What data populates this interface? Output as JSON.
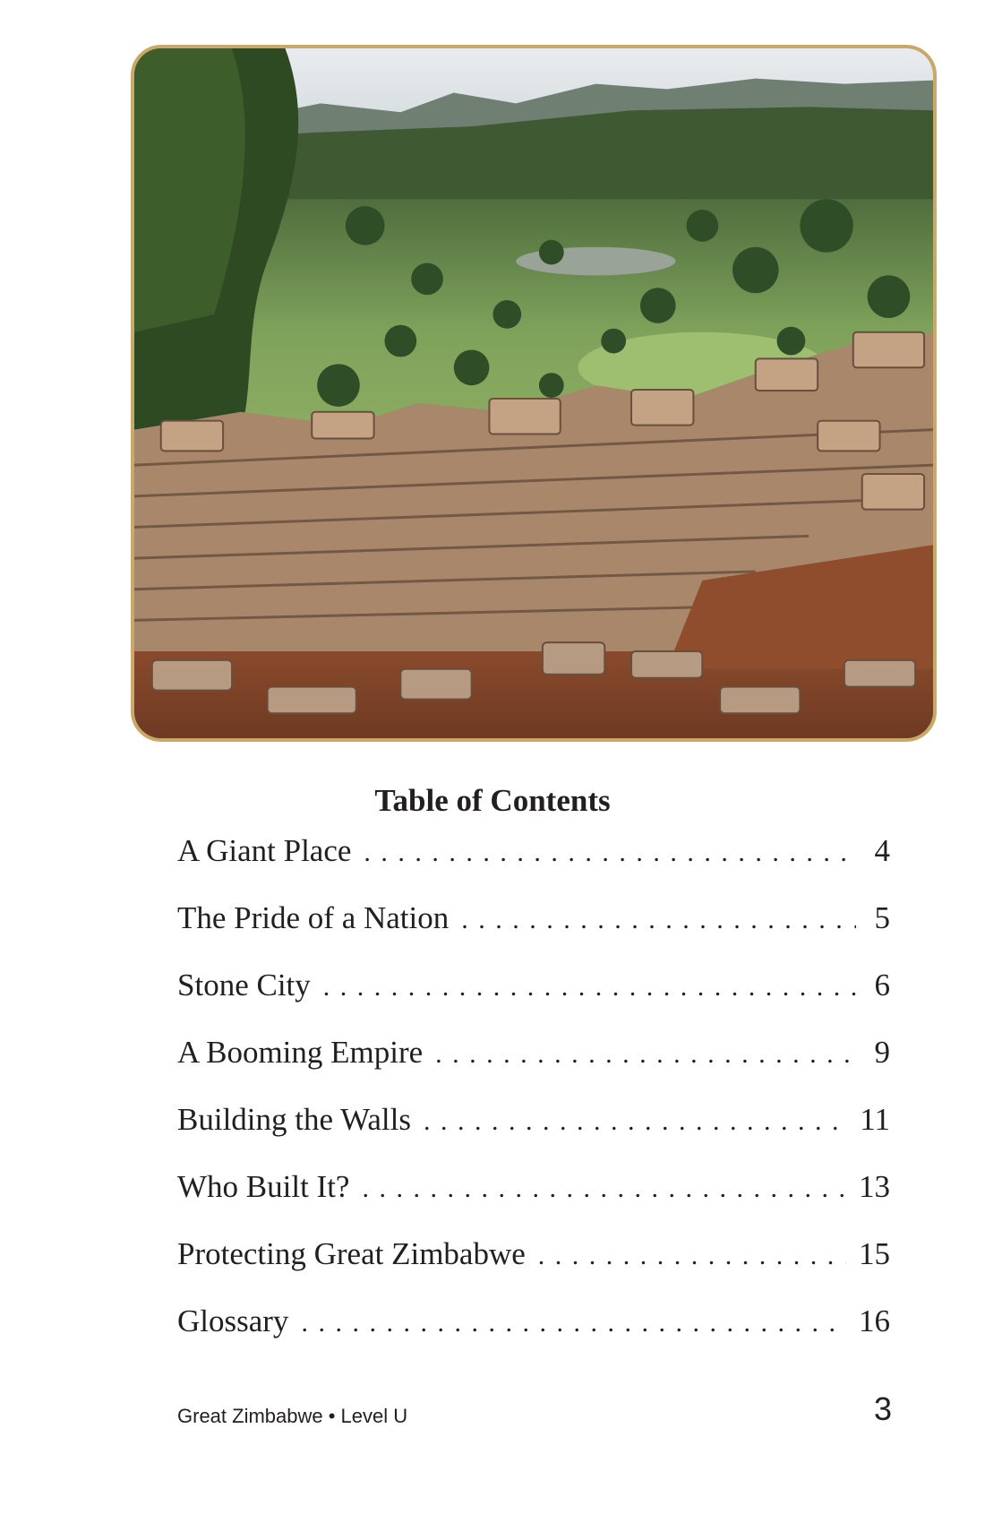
{
  "toc": {
    "title": "Table of Contents",
    "entries": [
      {
        "label": "A Giant Place",
        "page": "4"
      },
      {
        "label": "The Pride of a Nation",
        "page": "5"
      },
      {
        "label": "Stone City",
        "page": "6"
      },
      {
        "label": "A Booming Empire",
        "page": "9"
      },
      {
        "label": "Building the Walls",
        "page": "11"
      },
      {
        "label": "Who Built It?",
        "page": "13"
      },
      {
        "label": "Protecting Great Zimbabwe",
        "page": "15"
      },
      {
        "label": "Glossary",
        "page": "16"
      }
    ]
  },
  "footer": {
    "book_title": "Great Zimbabwe • Level U",
    "page_number": "3"
  },
  "colors": {
    "frame_border": "#c9a96a",
    "text": "#231f20"
  }
}
